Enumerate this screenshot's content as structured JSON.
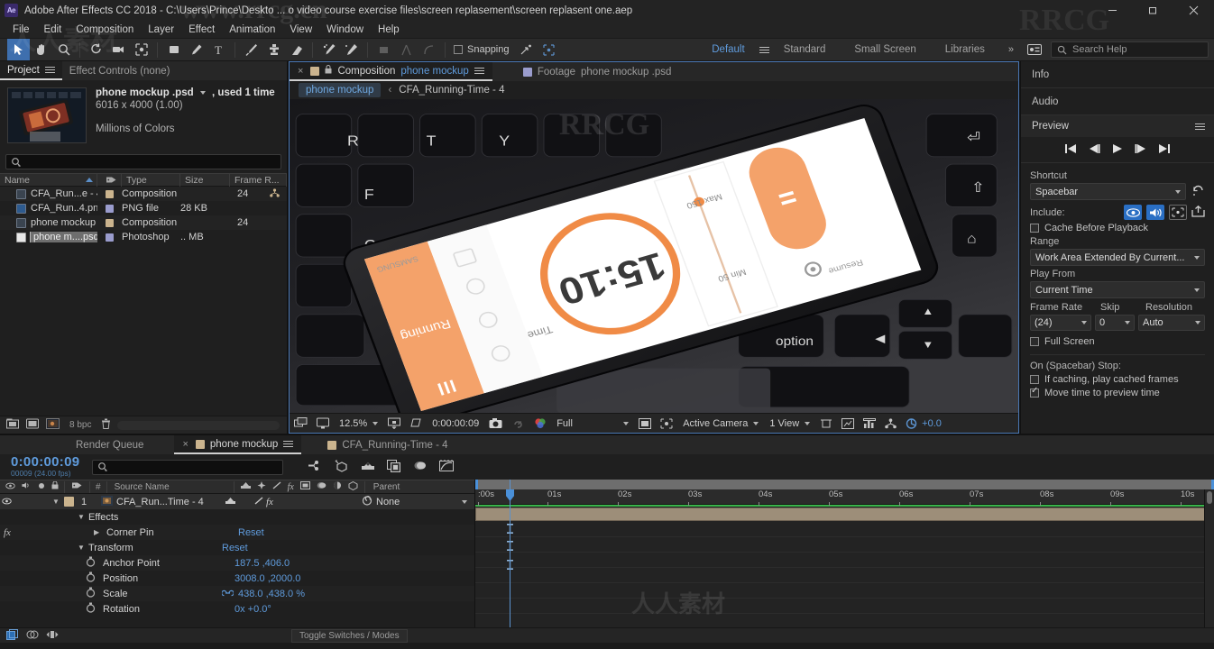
{
  "window": {
    "title": "Adobe After Effects CC 2018 - C:\\Users\\Prince\\Deskto ... o video course exercise files\\screen replasement\\screen replasent one.aep",
    "logo": "Ae",
    "minimize": "—",
    "maximize": "❐",
    "close": "✕"
  },
  "menubar": {
    "items": [
      "File",
      "Edit",
      "Composition",
      "Layer",
      "Effect",
      "Animation",
      "View",
      "Window",
      "Help"
    ]
  },
  "toolbar": {
    "tools": [
      {
        "name": "selection-tool",
        "selected": true
      },
      {
        "name": "hand-tool",
        "selected": false
      },
      {
        "name": "zoom-tool",
        "selected": false
      },
      {
        "name": "rotation-tool",
        "selected": false
      },
      {
        "name": "camera-tool",
        "selected": false
      },
      {
        "name": "pan-behind-tool",
        "selected": false
      },
      {
        "name": "shape-tool",
        "selected": false
      },
      {
        "name": "pen-tool",
        "selected": false
      },
      {
        "name": "type-tool",
        "selected": false
      },
      {
        "name": "brush-tool",
        "selected": false
      },
      {
        "name": "clone-stamp-tool",
        "selected": false
      },
      {
        "name": "eraser-tool",
        "selected": false
      },
      {
        "name": "roto-brush-tool",
        "selected": false
      },
      {
        "name": "puppet-pin-tool",
        "selected": false
      }
    ],
    "snapping_label": "Snapping",
    "snapping_checked": false,
    "workspaces": [
      "Default",
      "Standard",
      "Small Screen",
      "Libraries"
    ],
    "workspace_active": "Default",
    "overflow": "»",
    "search_help_placeholder": "Search Help"
  },
  "project": {
    "tabs": [
      {
        "label": "Project",
        "active": true
      },
      {
        "label": "Effect Controls  (none)",
        "active": false
      }
    ],
    "selected_asset": {
      "name": "phone mockup .psd",
      "usage": ", used 1 time",
      "dimensions": "6016 x 4000 (1.00)",
      "colors": "Millions of Colors"
    },
    "search_placeholder": "",
    "columns": [
      "Name",
      "Type",
      "Size",
      "Frame R..."
    ],
    "assets": [
      {
        "name": "CFA_Run...e - 4",
        "type": "Composition",
        "size": "",
        "frame_rate": "24",
        "swatch": "#cbb48e",
        "icon": "composition-icon"
      },
      {
        "name": "CFA_Run..4.png",
        "type": "PNG file",
        "size": "28 KB",
        "frame_rate": "",
        "swatch": "#9a9ccd",
        "icon": "image-icon"
      },
      {
        "name": "phone mockup",
        "type": "Composition",
        "size": "",
        "frame_rate": "24",
        "swatch": "#cbb48e",
        "icon": "composition-icon"
      },
      {
        "name": "phone m....psd",
        "type": "Photoshop",
        "size": ".. MB",
        "frame_rate": "",
        "swatch": "#9a9ccd",
        "icon": "psd-icon"
      }
    ],
    "bpc": "8 bpc"
  },
  "composition": {
    "tabs": [
      {
        "label_prefix": "Composition",
        "label_name": "phone mockup",
        "active": true
      },
      {
        "label_prefix": "Footage",
        "label_name": "phone mockup .psd",
        "active": false
      }
    ],
    "breadcrumb_chip": "phone mockup",
    "breadcrumb_sep": "‹",
    "breadcrumb_current": "CFA_Running-Time - 4",
    "viewer": {
      "phone_time": "15:10",
      "phone_time_label": "Time",
      "phone_max_label": "Max 150",
      "phone_min_label": "Min 50",
      "phone_running_label": "Running",
      "phone_resume_label": "Resume",
      "phone_brand": "SAMSUNG",
      "key_t": "T",
      "key_y": "Y",
      "key_r": "R",
      "key_f": "F",
      "key_c": "C",
      "key_option": "option"
    },
    "bottom_bar": {
      "zoom": "12.5%",
      "timecode": "0:00:00:09",
      "resolution": "Full",
      "view_camera": "Active Camera",
      "view_count": "1 View",
      "exposure": "+0.0"
    }
  },
  "right_panel": {
    "info_tab": "Info",
    "audio_tab": "Audio",
    "preview_tab": "Preview",
    "shortcut_label": "Shortcut",
    "shortcut_value": "Spacebar",
    "include_label": "Include:",
    "cache_before_playback": {
      "label": "Cache Before Playback",
      "checked": false
    },
    "range_label": "Range",
    "range_value": "Work Area Extended By Current...",
    "play_from_label": "Play From",
    "play_from_value": "Current Time",
    "frame_rate_label": "Frame Rate",
    "frame_rate_value": "(24)",
    "skip_label": "Skip",
    "skip_value": "0",
    "resolution_label": "Resolution",
    "resolution_value": "Auto",
    "full_screen": {
      "label": "Full Screen",
      "checked": false
    },
    "on_stop_label": "On (Spacebar) Stop:",
    "if_caching": {
      "label": "If caching, play cached frames",
      "checked": false
    },
    "move_time": {
      "label": "Move time to preview time",
      "checked": true
    }
  },
  "timeline": {
    "tabs": [
      {
        "label": "Render Queue",
        "active": false
      },
      {
        "label": "phone mockup",
        "active": true
      },
      {
        "label": "CFA_Running-Time - 4",
        "active": false
      }
    ],
    "current_time": "0:00:00:09",
    "current_frame": "00009 (24.00 fps)",
    "search_placeholder": "",
    "columns": {
      "source_name": "Source Name",
      "parent": "Parent"
    },
    "layer": {
      "index": "1",
      "name": "CFA_Run...Time - 4",
      "parent": "None"
    },
    "properties": [
      {
        "label": "Effects",
        "value": "",
        "indent": 1,
        "twirl": "down"
      },
      {
        "label": "Corner Pin",
        "value": "Reset",
        "indent": 2,
        "twirl": "right"
      },
      {
        "label": "Transform",
        "value": "Reset",
        "indent": 1,
        "twirl": "down"
      },
      {
        "label": "Anchor Point",
        "value": "187.5 ,406.0",
        "indent": 3,
        "twirl": "none"
      },
      {
        "label": "Position",
        "value": "3008.0 ,2000.0",
        "indent": 3,
        "twirl": "none"
      },
      {
        "label": "Scale",
        "value": "438.0 ,438.0 %",
        "indent": 3,
        "twirl": "none"
      },
      {
        "label": "Rotation",
        "value": "0x +0.0°",
        "indent": 3,
        "twirl": "none"
      }
    ],
    "ruler_ticks": [
      ":00s",
      "01s",
      "02s",
      "03s",
      "04s",
      "05s",
      "06s",
      "07s",
      "08s",
      "09s",
      "10s"
    ],
    "toggle_switches": "Toggle Switches / Modes"
  },
  "colors": {
    "accent_blue": "#5f9bdc",
    "layer_bar": "#9d8e79",
    "green_bar": "#39b54a",
    "panel_bg": "#1f1f1f",
    "orange": "#f4a26a"
  },
  "watermarks": {
    "site": "www.rrcg.cn",
    "mark1": "RRCG",
    "mark2": "人人素材"
  }
}
